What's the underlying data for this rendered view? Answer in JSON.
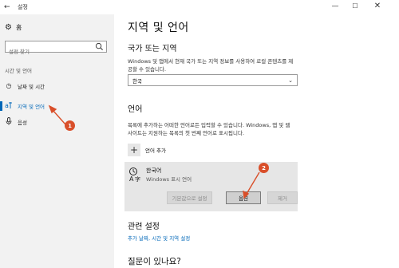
{
  "window": {
    "title": "설정",
    "back_glyph": "←",
    "minimize_glyph": "—",
    "maximize_glyph": "☐",
    "close_glyph": "✕"
  },
  "sidebar": {
    "home_label": "홈",
    "home_icon": "gear-icon",
    "search_placeholder": "설정 찾기",
    "search_icon": "search-icon",
    "section_label": "시간 및 언어",
    "items": [
      {
        "label": "날짜 및 시간",
        "icon": "calendar-clock-icon",
        "glyph": "◷",
        "active": false
      },
      {
        "label": "지역 및 언어",
        "icon": "region-language-icon",
        "glyph": "A",
        "active": true
      },
      {
        "label": "음성",
        "icon": "microphone-icon",
        "glyph": "🎙",
        "active": false
      }
    ]
  },
  "main": {
    "title": "지역 및 언어",
    "country": {
      "heading": "국가 또는 지역",
      "description": "Windows 및 앱에서 현재 국가 또는 지역 정보를 사용하여 로컬 콘텐츠를 제공할 수 있습니다.",
      "selected": "한국"
    },
    "language": {
      "heading": "언어",
      "description": "목록에 추가하는 어떠한 언어로든 입력할 수 있습니다. Windows, 앱 및 웹 사이트는 지원하는 목록의 첫 번째 언어로 표시됩니다.",
      "add_label": "언어 추가",
      "entry": {
        "name": "한국어",
        "subtitle": "Windows 표시 언어",
        "buttons": {
          "set_default": "기본값으로 설정",
          "options": "옵션",
          "remove": "제거"
        }
      }
    },
    "related": {
      "heading": "관련 설정",
      "link": "추가 날짜, 시간 및 지역 설정"
    },
    "question": {
      "heading": "질문이 있나요?"
    }
  },
  "annotations": {
    "marker1": "1",
    "marker2": "2",
    "color": "#d94f2a"
  },
  "colors": {
    "accent": "#0067b8",
    "sidebar_bg": "#f2f2f2",
    "card_bg": "#e6e6e6"
  }
}
